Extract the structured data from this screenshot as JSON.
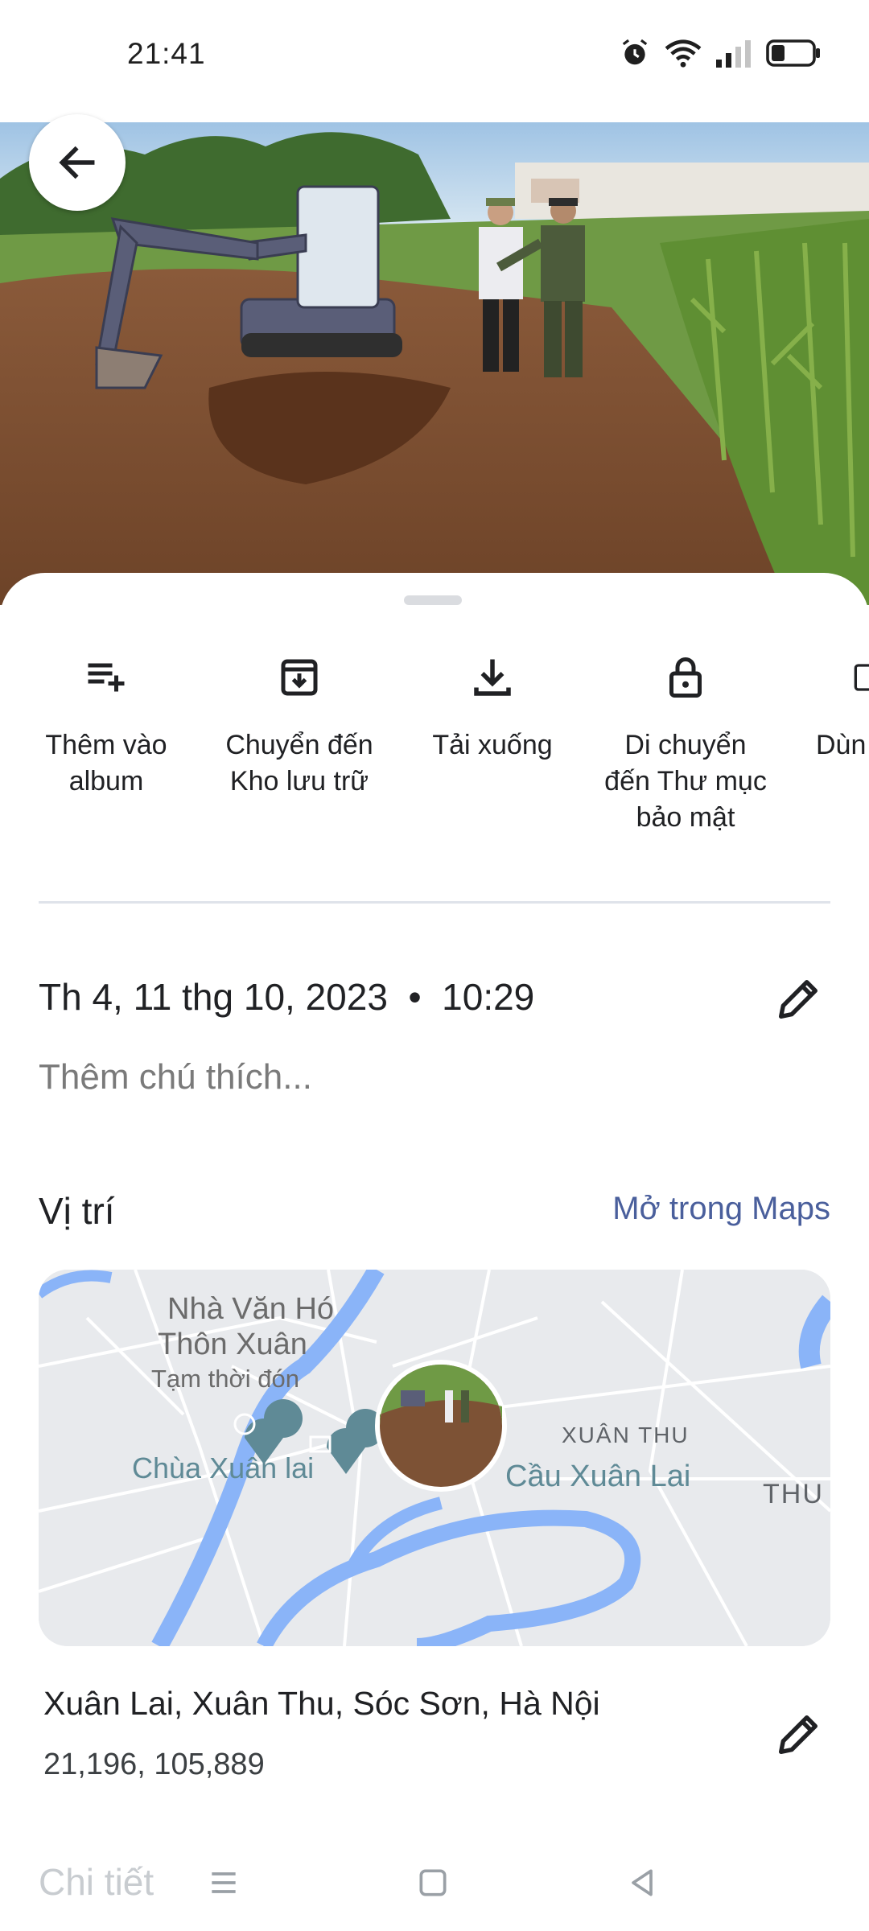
{
  "status_bar": {
    "time": "21:41",
    "icons": [
      "alarm-icon",
      "wifi-icon",
      "signal-icon",
      "battery-icon"
    ]
  },
  "photo": {
    "description_icon": "photo"
  },
  "actions": [
    {
      "label": "Thêm vào\nalbum",
      "icon": "playlist-add-icon"
    },
    {
      "label": "Chuyển đến\nKho lưu trữ",
      "icon": "archive-icon"
    },
    {
      "label": "Tải xuống",
      "icon": "download-icon"
    },
    {
      "label": "Di chuyển\nđến Thư mục\nbảo mật",
      "icon": "lock-icon"
    },
    {
      "label": "Dùn",
      "icon": "phone-icon"
    }
  ],
  "info": {
    "datetime": "Th 4, 11 thg 10, 2023  •  10:29",
    "caption_placeholder": "Thêm chú thích..."
  },
  "location": {
    "title": "Vị trí",
    "open_in_maps": "Mở trong Maps",
    "map_labels": {
      "nha_van_hoa_1": "Nhà Văn Hó",
      "nha_van_hoa_2": "Thôn Xuân",
      "tam_thoi": "Tạm thời đón",
      "chua": "Chùa Xuân lai",
      "cau": "Cầu Xuân Lai",
      "xuan_thu": "XUÂN THU",
      "thu": "THU"
    },
    "address": "Xuân Lai, Xuân Thu, Sóc Sơn, Hà Nội",
    "coordinates": "21,196, 105,889"
  },
  "details": {
    "title": "Chi tiết"
  },
  "colors": {
    "accent_link": "#4a5f9c",
    "river": "#8ab4f8",
    "map_bg": "#e8eaed",
    "pin": "#5f8a96"
  }
}
